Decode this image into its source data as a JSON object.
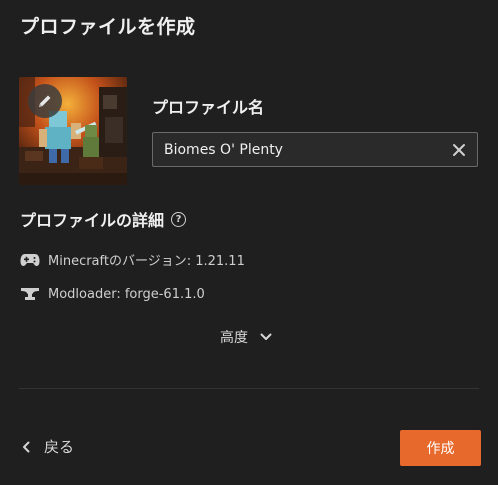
{
  "dialog": {
    "title": "プロファイルを作成"
  },
  "profile": {
    "name_label": "プロファイル名",
    "name_value": "Biomes O' Plenty",
    "thumbnail_icon": "edit-pencil-icon"
  },
  "details": {
    "title": "プロファイルの詳細",
    "help_icon": "?",
    "minecraft_version": "Minecraftのバージョン: 1.21.11",
    "modloader": "Modloader: forge-61.1.0"
  },
  "advanced": {
    "label": "高度"
  },
  "footer": {
    "back_label": "戻る",
    "create_label": "作成"
  },
  "colors": {
    "background": "#1f1f1f",
    "accent": "#e8692c",
    "text": "#e6e6e6"
  }
}
